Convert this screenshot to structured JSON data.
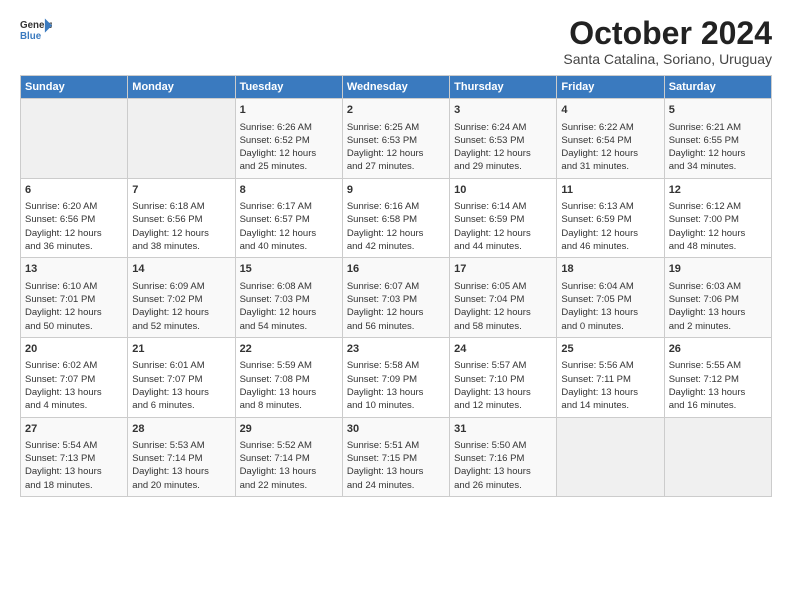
{
  "logo": {
    "line1": "General",
    "line2": "Blue"
  },
  "title": "October 2024",
  "subtitle": "Santa Catalina, Soriano, Uruguay",
  "days_of_week": [
    "Sunday",
    "Monday",
    "Tuesday",
    "Wednesday",
    "Thursday",
    "Friday",
    "Saturday"
  ],
  "weeks": [
    [
      {
        "day": "",
        "content": ""
      },
      {
        "day": "",
        "content": ""
      },
      {
        "day": "1",
        "content": "Sunrise: 6:26 AM\nSunset: 6:52 PM\nDaylight: 12 hours\nand 25 minutes."
      },
      {
        "day": "2",
        "content": "Sunrise: 6:25 AM\nSunset: 6:53 PM\nDaylight: 12 hours\nand 27 minutes."
      },
      {
        "day": "3",
        "content": "Sunrise: 6:24 AM\nSunset: 6:53 PM\nDaylight: 12 hours\nand 29 minutes."
      },
      {
        "day": "4",
        "content": "Sunrise: 6:22 AM\nSunset: 6:54 PM\nDaylight: 12 hours\nand 31 minutes."
      },
      {
        "day": "5",
        "content": "Sunrise: 6:21 AM\nSunset: 6:55 PM\nDaylight: 12 hours\nand 34 minutes."
      }
    ],
    [
      {
        "day": "6",
        "content": "Sunrise: 6:20 AM\nSunset: 6:56 PM\nDaylight: 12 hours\nand 36 minutes."
      },
      {
        "day": "7",
        "content": "Sunrise: 6:18 AM\nSunset: 6:56 PM\nDaylight: 12 hours\nand 38 minutes."
      },
      {
        "day": "8",
        "content": "Sunrise: 6:17 AM\nSunset: 6:57 PM\nDaylight: 12 hours\nand 40 minutes."
      },
      {
        "day": "9",
        "content": "Sunrise: 6:16 AM\nSunset: 6:58 PM\nDaylight: 12 hours\nand 42 minutes."
      },
      {
        "day": "10",
        "content": "Sunrise: 6:14 AM\nSunset: 6:59 PM\nDaylight: 12 hours\nand 44 minutes."
      },
      {
        "day": "11",
        "content": "Sunrise: 6:13 AM\nSunset: 6:59 PM\nDaylight: 12 hours\nand 46 minutes."
      },
      {
        "day": "12",
        "content": "Sunrise: 6:12 AM\nSunset: 7:00 PM\nDaylight: 12 hours\nand 48 minutes."
      }
    ],
    [
      {
        "day": "13",
        "content": "Sunrise: 6:10 AM\nSunset: 7:01 PM\nDaylight: 12 hours\nand 50 minutes."
      },
      {
        "day": "14",
        "content": "Sunrise: 6:09 AM\nSunset: 7:02 PM\nDaylight: 12 hours\nand 52 minutes."
      },
      {
        "day": "15",
        "content": "Sunrise: 6:08 AM\nSunset: 7:03 PM\nDaylight: 12 hours\nand 54 minutes."
      },
      {
        "day": "16",
        "content": "Sunrise: 6:07 AM\nSunset: 7:03 PM\nDaylight: 12 hours\nand 56 minutes."
      },
      {
        "day": "17",
        "content": "Sunrise: 6:05 AM\nSunset: 7:04 PM\nDaylight: 12 hours\nand 58 minutes."
      },
      {
        "day": "18",
        "content": "Sunrise: 6:04 AM\nSunset: 7:05 PM\nDaylight: 13 hours\nand 0 minutes."
      },
      {
        "day": "19",
        "content": "Sunrise: 6:03 AM\nSunset: 7:06 PM\nDaylight: 13 hours\nand 2 minutes."
      }
    ],
    [
      {
        "day": "20",
        "content": "Sunrise: 6:02 AM\nSunset: 7:07 PM\nDaylight: 13 hours\nand 4 minutes."
      },
      {
        "day": "21",
        "content": "Sunrise: 6:01 AM\nSunset: 7:07 PM\nDaylight: 13 hours\nand 6 minutes."
      },
      {
        "day": "22",
        "content": "Sunrise: 5:59 AM\nSunset: 7:08 PM\nDaylight: 13 hours\nand 8 minutes."
      },
      {
        "day": "23",
        "content": "Sunrise: 5:58 AM\nSunset: 7:09 PM\nDaylight: 13 hours\nand 10 minutes."
      },
      {
        "day": "24",
        "content": "Sunrise: 5:57 AM\nSunset: 7:10 PM\nDaylight: 13 hours\nand 12 minutes."
      },
      {
        "day": "25",
        "content": "Sunrise: 5:56 AM\nSunset: 7:11 PM\nDaylight: 13 hours\nand 14 minutes."
      },
      {
        "day": "26",
        "content": "Sunrise: 5:55 AM\nSunset: 7:12 PM\nDaylight: 13 hours\nand 16 minutes."
      }
    ],
    [
      {
        "day": "27",
        "content": "Sunrise: 5:54 AM\nSunset: 7:13 PM\nDaylight: 13 hours\nand 18 minutes."
      },
      {
        "day": "28",
        "content": "Sunrise: 5:53 AM\nSunset: 7:14 PM\nDaylight: 13 hours\nand 20 minutes."
      },
      {
        "day": "29",
        "content": "Sunrise: 5:52 AM\nSunset: 7:14 PM\nDaylight: 13 hours\nand 22 minutes."
      },
      {
        "day": "30",
        "content": "Sunrise: 5:51 AM\nSunset: 7:15 PM\nDaylight: 13 hours\nand 24 minutes."
      },
      {
        "day": "31",
        "content": "Sunrise: 5:50 AM\nSunset: 7:16 PM\nDaylight: 13 hours\nand 26 minutes."
      },
      {
        "day": "",
        "content": ""
      },
      {
        "day": "",
        "content": ""
      }
    ]
  ]
}
